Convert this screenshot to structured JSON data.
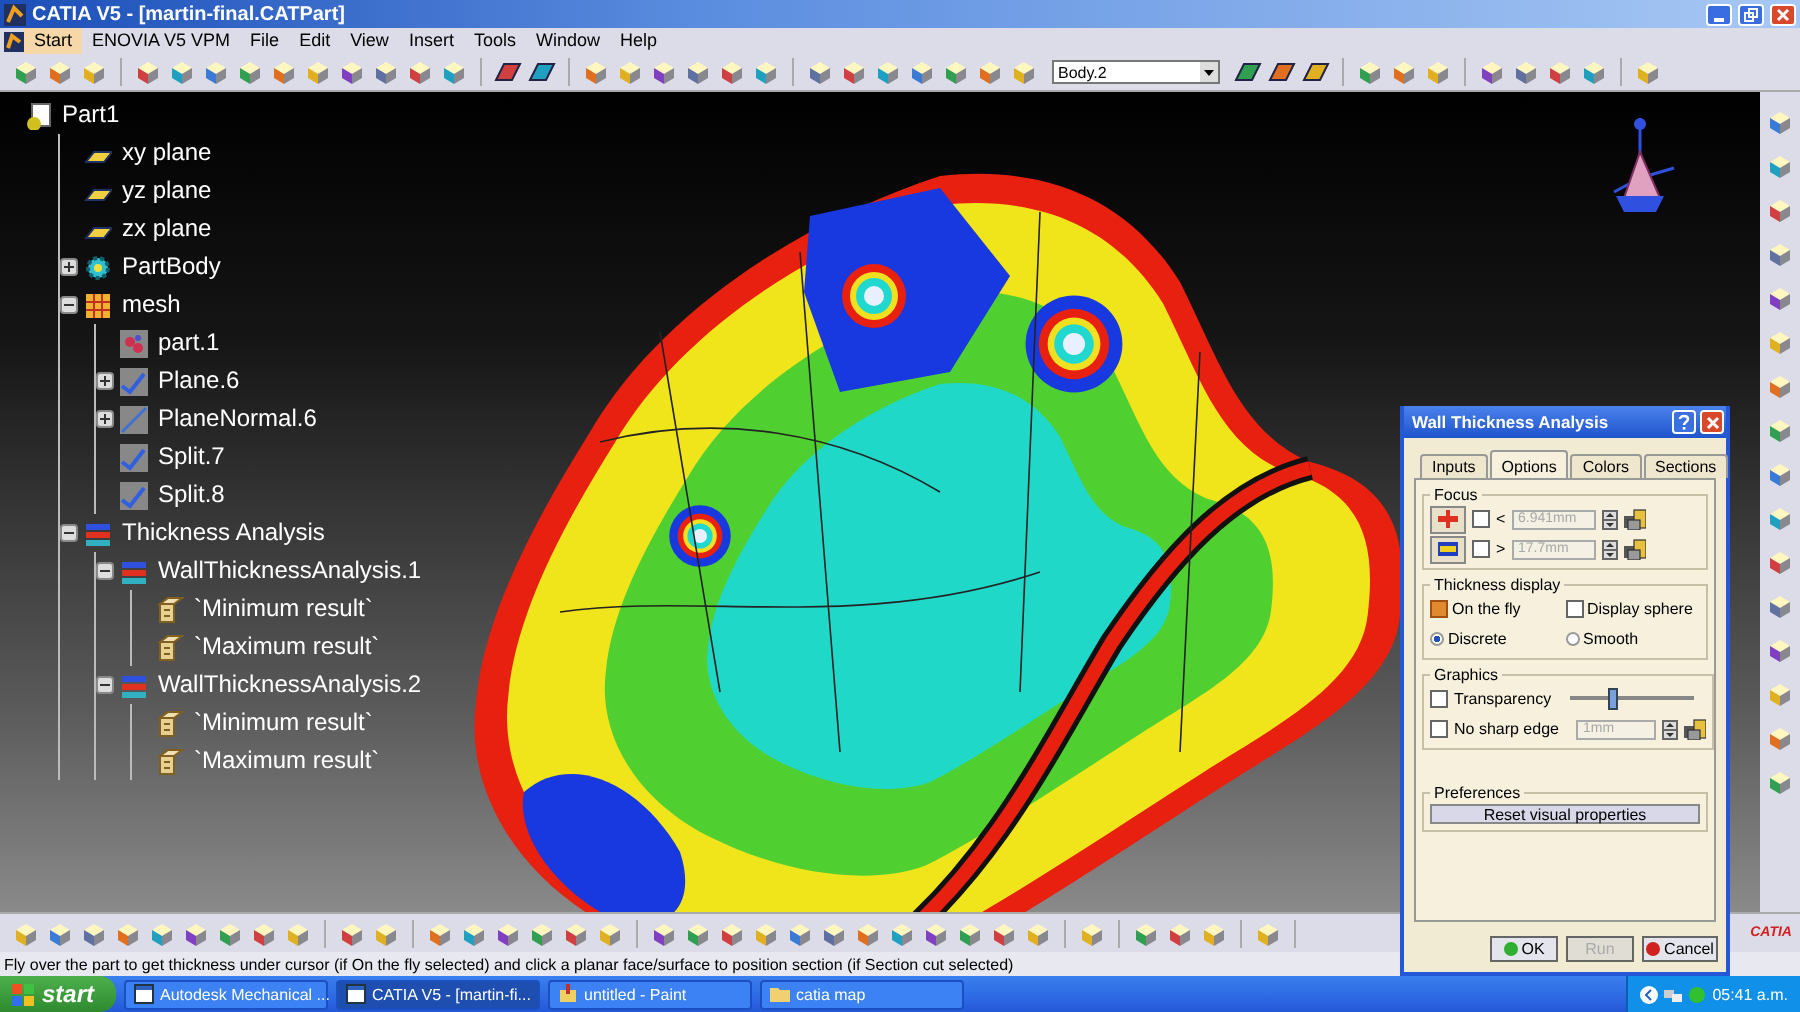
{
  "window": {
    "title": "CATIA V5 - [martin-final.CATPart]"
  },
  "menu": [
    {
      "label": "Start",
      "selected": true
    },
    {
      "label": "ENOVIA V5 VPM",
      "selected": false
    },
    {
      "label": "File",
      "selected": false
    },
    {
      "label": "Edit",
      "selected": false
    },
    {
      "label": "View",
      "selected": false
    },
    {
      "label": "Insert",
      "selected": false
    },
    {
      "label": "Tools",
      "selected": false
    },
    {
      "label": "Window",
      "selected": false
    },
    {
      "label": "Help",
      "selected": false
    }
  ],
  "toolbar": {
    "body_combo": "Body.2"
  },
  "tree": {
    "label": "Part1",
    "kind": "part",
    "children": [
      {
        "label": "xy plane",
        "kind": "plane"
      },
      {
        "label": "yz plane",
        "kind": "plane"
      },
      {
        "label": "zx plane",
        "kind": "plane"
      },
      {
        "label": "PartBody",
        "kind": "body",
        "expanded": false
      },
      {
        "label": "mesh",
        "kind": "mesh",
        "expanded": true,
        "children": [
          {
            "label": "part.1",
            "kind": "points"
          },
          {
            "label": "Plane.6",
            "kind": "feature",
            "expanded": false
          },
          {
            "label": "PlaneNormal.6",
            "kind": "line",
            "expanded": false
          },
          {
            "label": "Split.7",
            "kind": "feature"
          },
          {
            "label": "Split.8",
            "kind": "feature"
          }
        ]
      },
      {
        "label": "Thickness Analysis",
        "kind": "analysis",
        "expanded": true,
        "children": [
          {
            "label": "WallThicknessAnalysis.1",
            "kind": "analysis",
            "expanded": true,
            "children": [
              {
                "label": "`Minimum result`",
                "kind": "result"
              },
              {
                "label": "`Maximum result`",
                "kind": "result"
              }
            ]
          },
          {
            "label": "WallThicknessAnalysis.2",
            "kind": "analysis",
            "expanded": true,
            "children": [
              {
                "label": "`Minimum result`",
                "kind": "result"
              },
              {
                "label": "`Maximum result`",
                "kind": "result"
              }
            ]
          }
        ]
      }
    ]
  },
  "dialog": {
    "title": "Wall Thickness Analysis",
    "tabs": [
      {
        "label": "Inputs",
        "selected": false
      },
      {
        "label": "Options",
        "selected": true
      },
      {
        "label": "Colors",
        "selected": false
      },
      {
        "label": "Sections",
        "selected": false
      }
    ],
    "focus": {
      "title": "Focus",
      "rows": [
        {
          "checked": false,
          "operator": "<",
          "value": "6.941mm",
          "disabled": true
        },
        {
          "checked": false,
          "operator": ">",
          "value": "17.7mm",
          "disabled": true
        }
      ]
    },
    "thickness_display": {
      "title": "Thickness display",
      "options": [
        {
          "kind": "checkbox",
          "label": "On the fly",
          "checked": true
        },
        {
          "kind": "checkbox",
          "label": "Display sphere",
          "checked": false
        },
        {
          "kind": "radio",
          "label": "Discrete",
          "selected": true
        },
        {
          "kind": "radio",
          "label": "Smooth",
          "selected": false
        }
      ]
    },
    "graphics": {
      "title": "Graphics",
      "transparency": {
        "label": "Transparency",
        "checked": false,
        "level": 0.35
      },
      "sharp_edge": {
        "label": "No sharp edge",
        "checked": false,
        "value": "1mm",
        "disabled": true
      }
    },
    "preferences": {
      "title": "Preferences",
      "button": "Reset visual properties"
    },
    "buttons": [
      {
        "label": "OK",
        "kind": "ok",
        "disabled": false
      },
      {
        "label": "Run",
        "kind": "run",
        "disabled": true
      },
      {
        "label": "Cancel",
        "kind": "cancel",
        "disabled": false
      }
    ]
  },
  "status_bar": {
    "text": "Fly over the part to get thickness under cursor (if On the fly selected) and click a planar face/surface to position section (if Section cut selected)"
  },
  "logo": {
    "text": "CATIA"
  },
  "taskbar": {
    "start": "start",
    "tasks": [
      {
        "label": "Autodesk Mechanical ...",
        "kind": "app",
        "selected": false
      },
      {
        "label": "CATIA V5 - [martin-fi...",
        "kind": "app",
        "selected": true
      },
      {
        "label": "untitled - Paint",
        "kind": "paint",
        "selected": false
      },
      {
        "label": "catia map",
        "kind": "folder",
        "selected": false
      }
    ],
    "clock": "05:41 a.m."
  }
}
